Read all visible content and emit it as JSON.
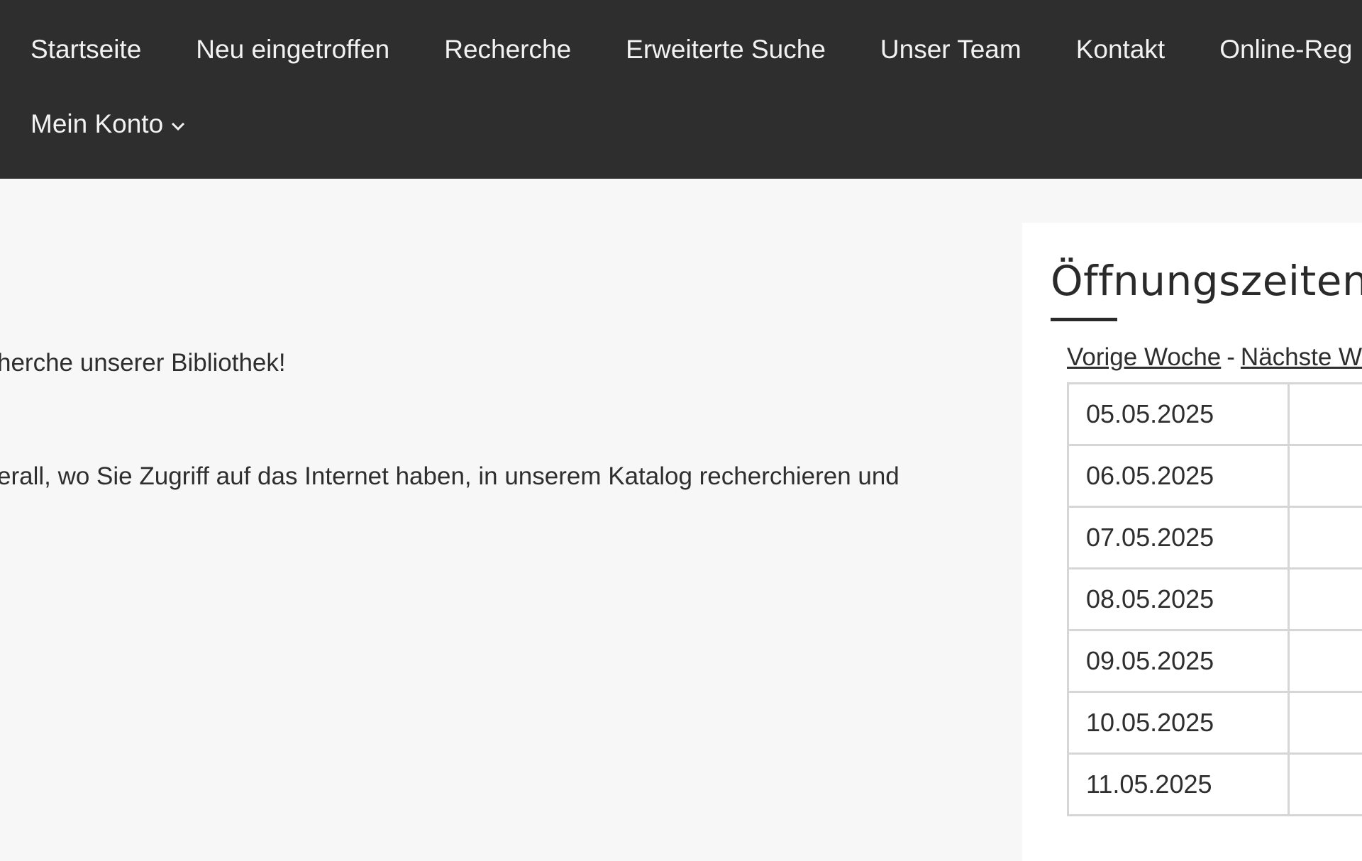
{
  "nav": {
    "row1": [
      {
        "label": "Startseite"
      },
      {
        "label": "Neu eingetroffen"
      },
      {
        "label": "Recherche"
      },
      {
        "label": "Erweiterte Suche"
      },
      {
        "label": "Unser Team"
      },
      {
        "label": "Kontakt"
      },
      {
        "label": "Online-Reg"
      }
    ],
    "account_label": "Mein Konto"
  },
  "main": {
    "paragraph1": "herche unserer Bibliothek!",
    "paragraph2": "erall, wo Sie Zugriff auf das Internet haben, in unserem Katalog recherchieren und"
  },
  "sidebar": {
    "title": "Öffnungszeiten",
    "prev_week": "Vorige Woche",
    "separator": "-",
    "next_week": "Nächste W",
    "dates": [
      "05.05.2025",
      "06.05.2025",
      "07.05.2025",
      "08.05.2025",
      "09.05.2025",
      "10.05.2025",
      "11.05.2025"
    ]
  }
}
